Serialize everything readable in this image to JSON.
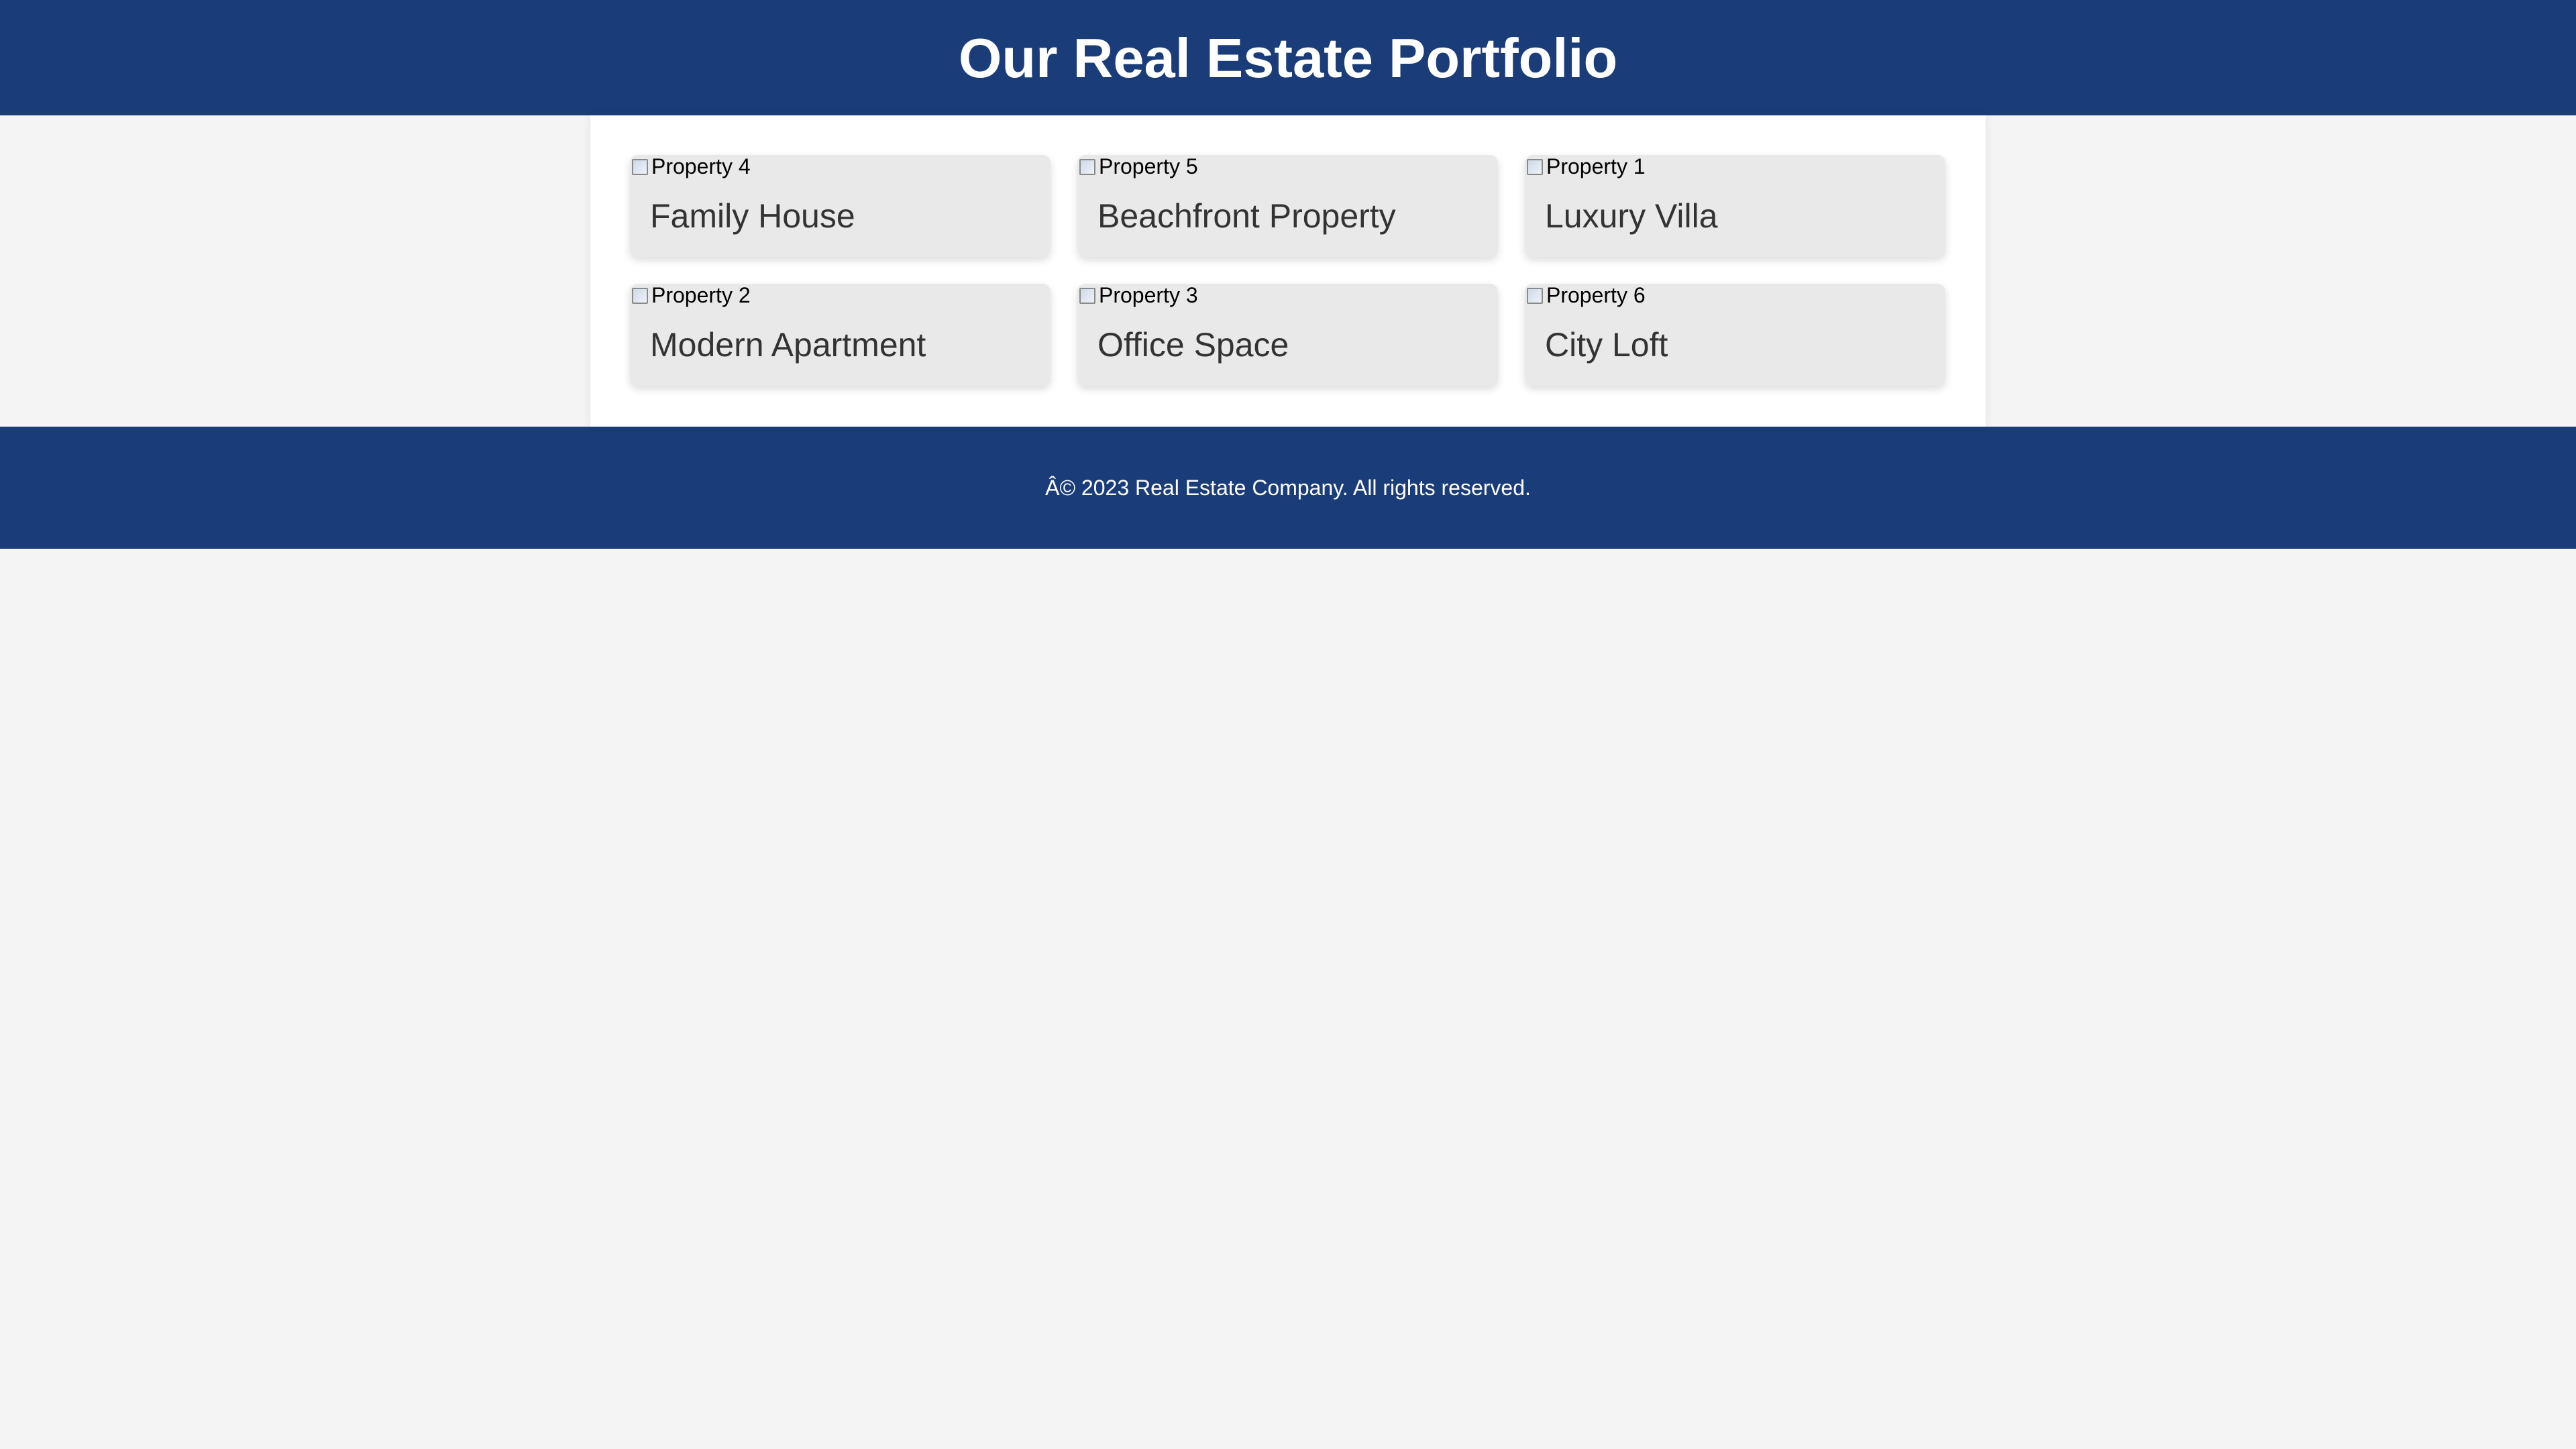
{
  "header": {
    "title": "Our Real Estate Portfolio"
  },
  "properties": [
    {
      "image_alt": "Property 4",
      "title": "Family House"
    },
    {
      "image_alt": "Property 5",
      "title": "Beachfront Property"
    },
    {
      "image_alt": "Property 1",
      "title": "Luxury Villa"
    },
    {
      "image_alt": "Property 2",
      "title": "Modern Apartment"
    },
    {
      "image_alt": "Property 3",
      "title": "Office Space"
    },
    {
      "image_alt": "Property 6",
      "title": "City Loft"
    }
  ],
  "footer": {
    "text": "Â© 2023 Real Estate Company. All rights reserved."
  },
  "colors": {
    "header_bg": "#1a3d7a",
    "page_bg": "#f4f4f4",
    "card_bg": "#e9e9e9",
    "title_text": "#333333"
  },
  "icons": {
    "broken_image": "broken-image-icon"
  }
}
